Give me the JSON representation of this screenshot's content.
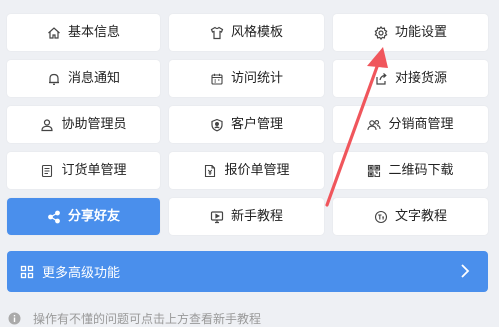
{
  "tiles": [
    {
      "label": "基本信息",
      "icon": "home-icon"
    },
    {
      "label": "风格模板",
      "icon": "shirt-icon"
    },
    {
      "label": "功能设置",
      "icon": "gear-icon"
    },
    {
      "label": "消息通知",
      "icon": "bell-icon"
    },
    {
      "label": "访问统计",
      "icon": "calendar-icon"
    },
    {
      "label": "对接货源",
      "icon": "share-icon"
    },
    {
      "label": "协助管理员",
      "icon": "user-icon"
    },
    {
      "label": "客户管理",
      "icon": "shield-icon"
    },
    {
      "label": "分销商管理",
      "icon": "users-icon"
    },
    {
      "label": "订货单管理",
      "icon": "list-doc-icon"
    },
    {
      "label": "报价单管理",
      "icon": "price-doc-icon"
    },
    {
      "label": "二维码下载",
      "icon": "qrcode-icon"
    },
    {
      "label": "分享好友",
      "icon": "share-nodes-icon"
    },
    {
      "label": "新手教程",
      "icon": "monitor-play-icon"
    },
    {
      "label": "文字教程",
      "icon": "text-tutorial-icon"
    }
  ],
  "more": {
    "label": "更多高级功能",
    "icon": "grid-icon"
  },
  "help": {
    "text": "操作有不懂的问题可点击上方查看新手教程"
  },
  "colors": {
    "primary": "#4a8fec",
    "arrow": "#f0565c",
    "background": "#eef0f4"
  }
}
